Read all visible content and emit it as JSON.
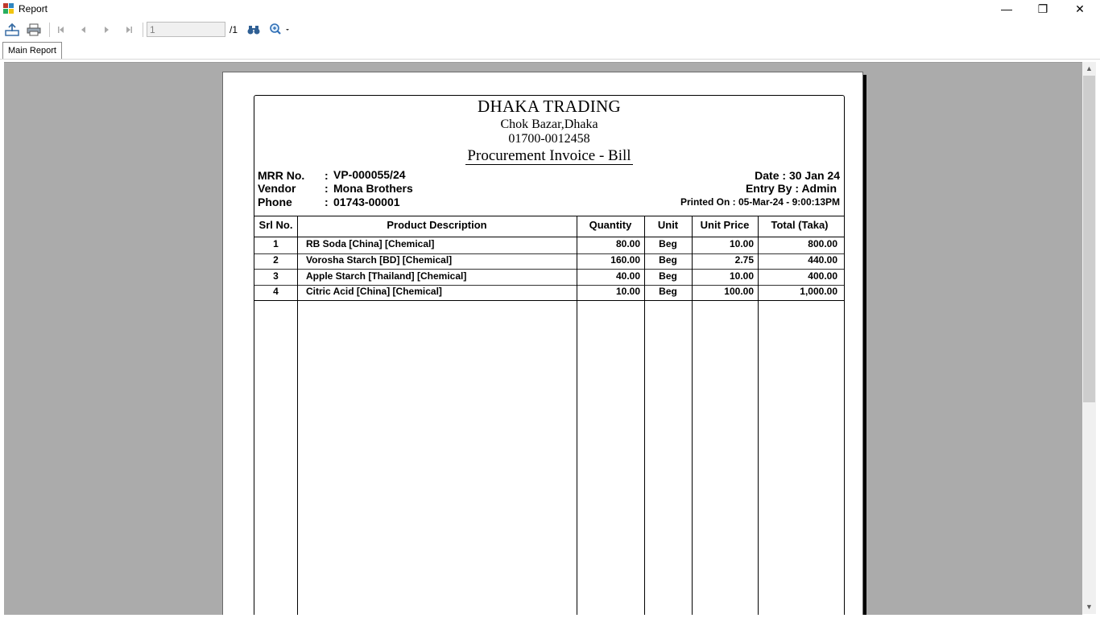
{
  "window": {
    "title": "Report",
    "minimize": "—",
    "restore": "❐",
    "close": "✕"
  },
  "toolbar": {
    "export": "export-icon",
    "print": "print-icon",
    "first": "first-page-icon",
    "prev": "prev-page-icon",
    "next": "next-page-icon",
    "last": "last-page-icon",
    "page_value": "1",
    "page_total": "/1",
    "find": "binoculars-icon",
    "zoom": "zoom-icon"
  },
  "tabs": [
    {
      "label": "Main Report"
    }
  ],
  "report": {
    "company": "DHAKA TRADING",
    "address": "Chok Bazar,Dhaka",
    "phone": "01700-0012458",
    "title": "Procurement Invoice - Bill",
    "fields": {
      "mrr_label": "MRR No.",
      "mrr_value": "VP-000055/24",
      "vendor_label": "Vendor",
      "vendor_value": "Mona Brothers",
      "phone_label": "Phone",
      "phone_value": "01743-00001",
      "colon": ":"
    },
    "date": "Date : 30 Jan 24",
    "entry_by": "Entry By : Admin",
    "printed_on": "Printed On : 05-Mar-24 -  9:00:13PM",
    "columns": [
      "Srl No.",
      "Product Description",
      "Quantity",
      "Unit",
      "Unit Price",
      "Total (Taka)"
    ],
    "rows": [
      {
        "srl": "1",
        "desc": "RB Soda [China] [Chemical]",
        "qty": "80.00",
        "unit": "Beg",
        "price": "10.00",
        "total": "800.00"
      },
      {
        "srl": "2",
        "desc": "Vorosha Starch [BD] [Chemical]",
        "qty": "160.00",
        "unit": "Beg",
        "price": "2.75",
        "total": "440.00"
      },
      {
        "srl": "3",
        "desc": "Apple Starch [Thailand] [Chemical]",
        "qty": "40.00",
        "unit": "Beg",
        "price": "10.00",
        "total": "400.00"
      },
      {
        "srl": "4",
        "desc": "Citric Acid [China] [Chemical]",
        "qty": "10.00",
        "unit": "Beg",
        "price": "100.00",
        "total": "1,000.00"
      }
    ]
  }
}
